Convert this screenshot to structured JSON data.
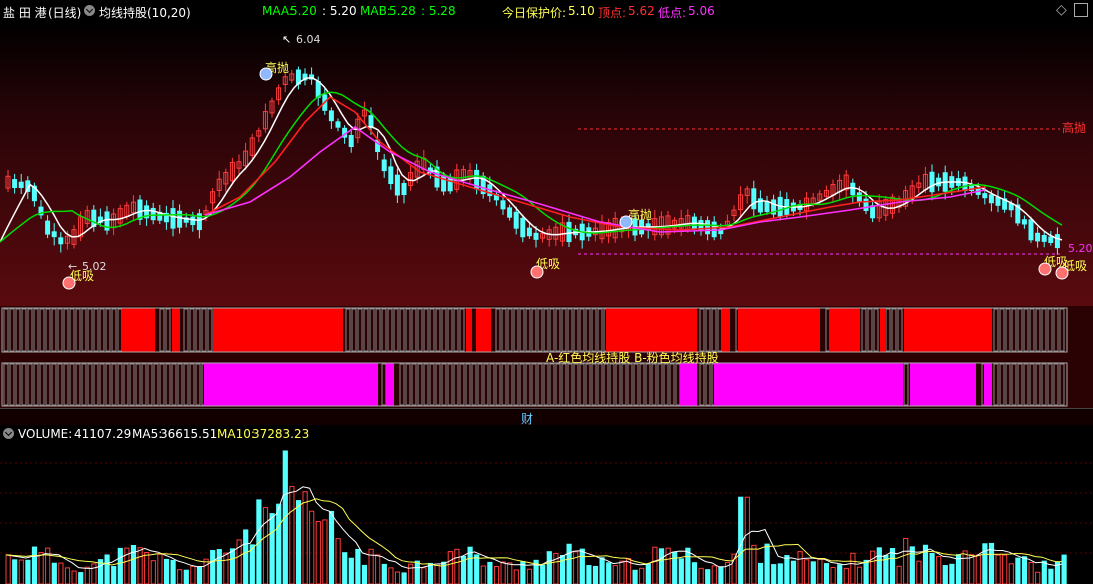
{
  "header": {
    "stock_name": "盐 田 港",
    "period": "(日线)",
    "indicator": "均线持股(10,20)",
    "maa_label": "MAA:",
    "maa_value": "5.20",
    "maa_colon_value": ": 5.20",
    "mab_label": "MAB:",
    "mab_value": "5.28",
    "mab_colon_value": ": 5.28",
    "protect_label": "今日保护价:",
    "protect_value": "5.10",
    "top_label": "顶点:",
    "top_value": "5.62",
    "low_label": "低点:",
    "low_value": "5.06"
  },
  "chart_labels": {
    "high_price": "6.04",
    "low_price": "5.02",
    "right_price": "5.20",
    "sell_label": "高抛",
    "buy_label": "低吸",
    "indicator_caption": "A-红色均线持股 B-粉色均线持股",
    "divider_label": "财"
  },
  "volume_header": {
    "volume_label": "VOLUME:",
    "volume_value": "41107.29",
    "ma5_label": "MA5:",
    "ma5_value": "36615.51",
    "ma10_label": "MA10:",
    "ma10_value": "37283.23"
  },
  "colors": {
    "up": "#ff3c3c",
    "down": "#54ffff",
    "ma_white": "#ffffff",
    "ma_green": "#00dd00",
    "ma_red": "#ff2020",
    "ma_pink": "#ff30ff",
    "yellow": "#ffff54",
    "magenta": "#ff00ff"
  }
}
